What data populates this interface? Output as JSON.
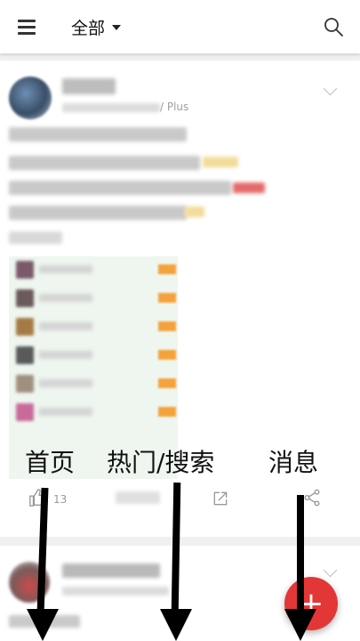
{
  "header": {
    "filter_label": "全部",
    "icons": {
      "menu": "hamburger-menu-icon",
      "search": "search-icon",
      "dropdown": "caret-down-icon"
    }
  },
  "post1": {
    "membership": "/ Plus",
    "like_count": "13",
    "icons": {
      "like": "thumbs-up-icon",
      "share": "share-external-icon",
      "more": "share-nodes-icon"
    }
  },
  "post2": {},
  "annotations": {
    "home": "首页",
    "hot_search": "热门/搜索",
    "messages": "消息"
  },
  "fab": {
    "label": "+"
  },
  "colors": {
    "accent_red": "#e33737",
    "tag_orange": "#f4a23b",
    "table_bg": "#eef6ef"
  }
}
